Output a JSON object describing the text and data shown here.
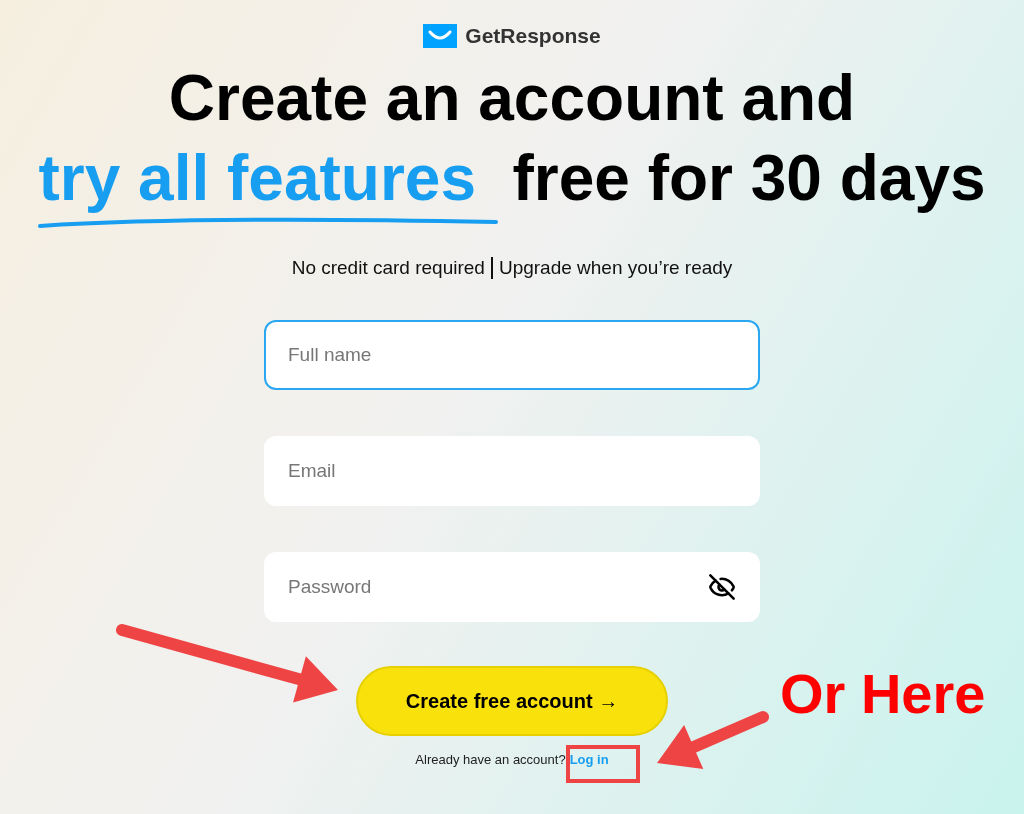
{
  "brand": {
    "name": "GetResponse"
  },
  "headline": {
    "line1": "Create an account and",
    "highlight": "try all features",
    "rest": "free for 30 days"
  },
  "subtitle": {
    "left": "No credit card required",
    "right": "Upgrade when you’re ready"
  },
  "fields": [
    {
      "kind": "text",
      "placeholder": "Full name",
      "focused": true
    },
    {
      "kind": "text",
      "placeholder": "Email",
      "focused": false
    },
    {
      "kind": "password",
      "placeholder": "Password",
      "focused": false
    }
  ],
  "submit": {
    "label": "Create free account →"
  },
  "login": {
    "prompt": "Already have an account?",
    "link": "Log in"
  },
  "annotation": {
    "text": "Or Here"
  }
}
